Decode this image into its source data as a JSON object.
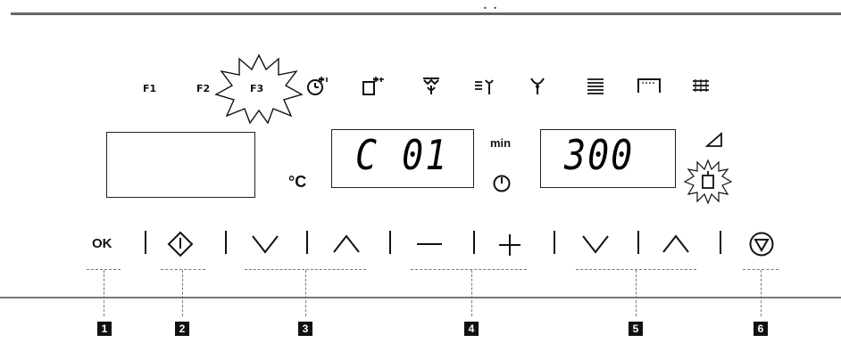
{
  "functions": [
    "F1",
    "F2",
    "F3"
  ],
  "icons": [
    "oven-mode-icon",
    "cooling-mode-icon",
    "grill-fan-icon",
    "fan-plant-icon",
    "fan-icon",
    "top-heat-icon",
    "tray-icon",
    "grill-icon"
  ],
  "display": {
    "temp_unit": "°C",
    "program_value": "C 01",
    "time_label": "min",
    "time_value": "300"
  },
  "buttons": {
    "ok_label": "OK",
    "minus_label": "—",
    "plus_label": "+"
  },
  "callouts": [
    "1",
    "2",
    "3",
    "4",
    "5",
    "6"
  ]
}
